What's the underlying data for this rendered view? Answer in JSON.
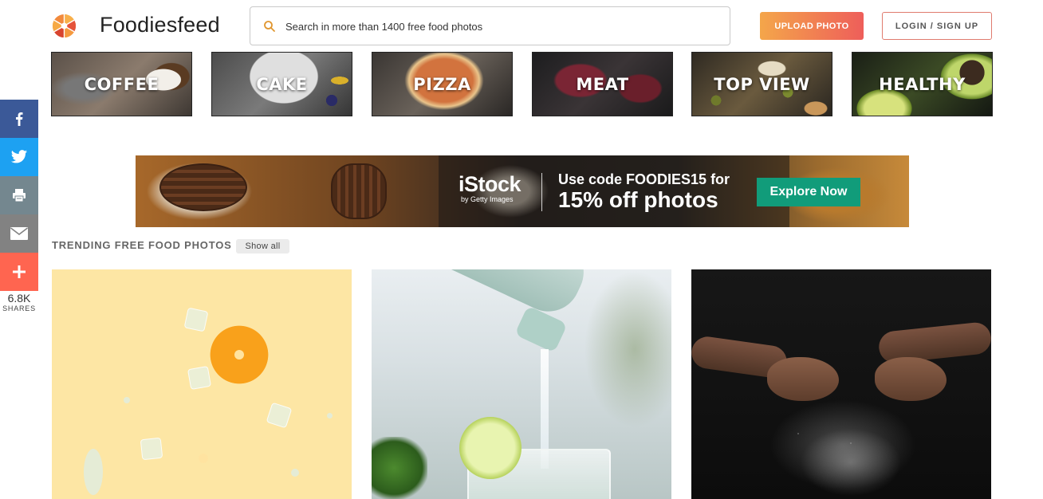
{
  "header": {
    "brand": "Foodiesfeed",
    "search_placeholder": "Search in more than 1400 free food photos",
    "upload_label": "UPLOAD PHOTO",
    "login_label": "LOGIN / SIGN UP"
  },
  "categories": [
    {
      "label": "COFFEE"
    },
    {
      "label": "CAKE"
    },
    {
      "label": "PIZZA"
    },
    {
      "label": "MEAT"
    },
    {
      "label": "TOP VIEW"
    },
    {
      "label": "HEALTHY"
    }
  ],
  "share": {
    "icons": [
      "facebook-icon",
      "twitter-icon",
      "print-icon",
      "email-icon",
      "plus-icon"
    ],
    "count": "6.8K",
    "count_label": "SHARES"
  },
  "ad": {
    "brand": "iStock",
    "brand_sub": "by Getty Images",
    "line1": "Use code FOODIES15 for",
    "line2": "15% off photos",
    "cta": "Explore Now"
  },
  "trending": {
    "title": "TRENDING FREE FOOD PHOTOS",
    "show_all": "Show all"
  },
  "colors": {
    "accent_gradient_start": "#f4a64a",
    "accent_gradient_end": "#ee5e5a",
    "facebook": "#3b5998",
    "twitter": "#1da1f2",
    "print": "#74878f",
    "email": "#828282",
    "plus": "#ff6550",
    "ad_cta": "#119c7a"
  }
}
